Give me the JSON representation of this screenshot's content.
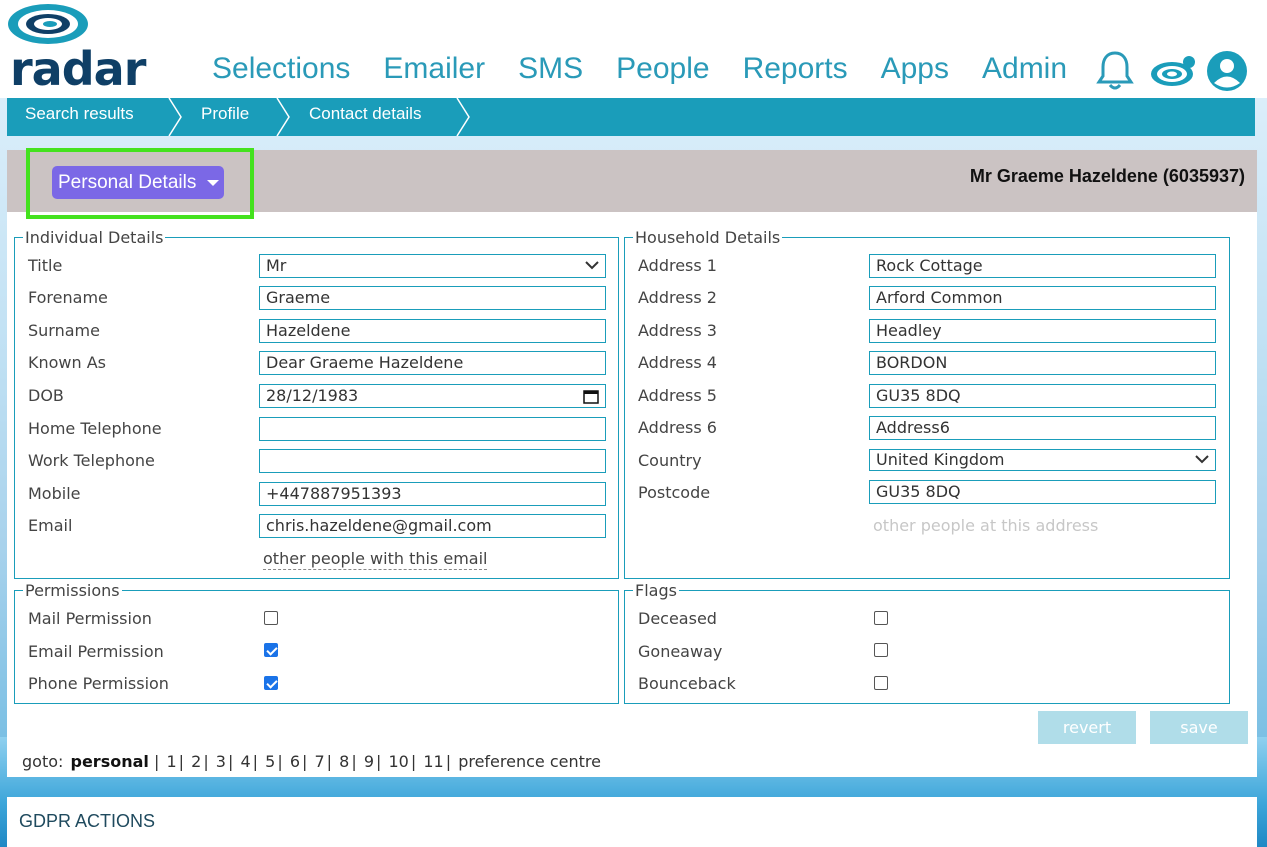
{
  "app": {
    "logo_text": "radar"
  },
  "nav": [
    "Selections",
    "Emailer",
    "SMS",
    "People",
    "Reports",
    "Apps",
    "Admin"
  ],
  "breadcrumb": [
    "Search results",
    "Profile",
    "Contact details"
  ],
  "panel": {
    "section_button": "Personal Details",
    "person_name": "Mr Graeme Hazeldene (6035937)"
  },
  "individual": {
    "legend": "Individual Details",
    "fields": [
      {
        "label": "Title",
        "value": "Mr",
        "type": "select"
      },
      {
        "label": "Forename",
        "value": "Graeme"
      },
      {
        "label": "Surname",
        "value": "Hazeldene"
      },
      {
        "label": "Known As",
        "value": "Dear Graeme Hazeldene"
      },
      {
        "label": "DOB",
        "value": "28/12/1983",
        "type": "date"
      },
      {
        "label": "Home Telephone",
        "value": ""
      },
      {
        "label": "Work Telephone",
        "value": ""
      },
      {
        "label": "Mobile",
        "value": "+447887951393"
      },
      {
        "label": "Email",
        "value": "chris.hazeldene@gmail.com"
      }
    ],
    "email_link": "other people with this email"
  },
  "household": {
    "legend": "Household Details",
    "fields": [
      {
        "label": "Address 1",
        "value": "Rock Cottage"
      },
      {
        "label": "Address 2",
        "value": "Arford Common"
      },
      {
        "label": "Address 3",
        "value": "Headley"
      },
      {
        "label": "Address 4",
        "value": "BORDON"
      },
      {
        "label": "Address 5",
        "value": "GU35 8DQ"
      },
      {
        "label": "Address 6",
        "value": "Address6"
      },
      {
        "label": "Country",
        "value": "United Kingdom",
        "type": "select"
      },
      {
        "label": "Postcode",
        "value": "GU35 8DQ"
      }
    ],
    "address_link": "other people at this address"
  },
  "permissions": {
    "legend": "Permissions",
    "items": [
      {
        "label": "Mail Permission",
        "checked": false
      },
      {
        "label": "Email Permission",
        "checked": true
      },
      {
        "label": "Phone Permission",
        "checked": true
      }
    ]
  },
  "flags": {
    "legend": "Flags",
    "items": [
      {
        "label": "Deceased",
        "checked": false
      },
      {
        "label": "Goneaway",
        "checked": false
      },
      {
        "label": "Bounceback",
        "checked": false
      }
    ]
  },
  "actions": {
    "revert": "revert",
    "save": "save"
  },
  "goto": {
    "label": "goto:",
    "current": "personal",
    "pages": [
      "1",
      "2",
      "3",
      "4",
      "5",
      "6",
      "7",
      "8",
      "9",
      "10",
      "11"
    ],
    "last": "preference centre"
  },
  "gdpr": {
    "title": "GDPR ACTIONS"
  },
  "colors": {
    "accent": "#1a9dba",
    "button_purple": "#7b68e6",
    "highlight": "#44e21e",
    "nav_blue": "#2a9ab8"
  }
}
